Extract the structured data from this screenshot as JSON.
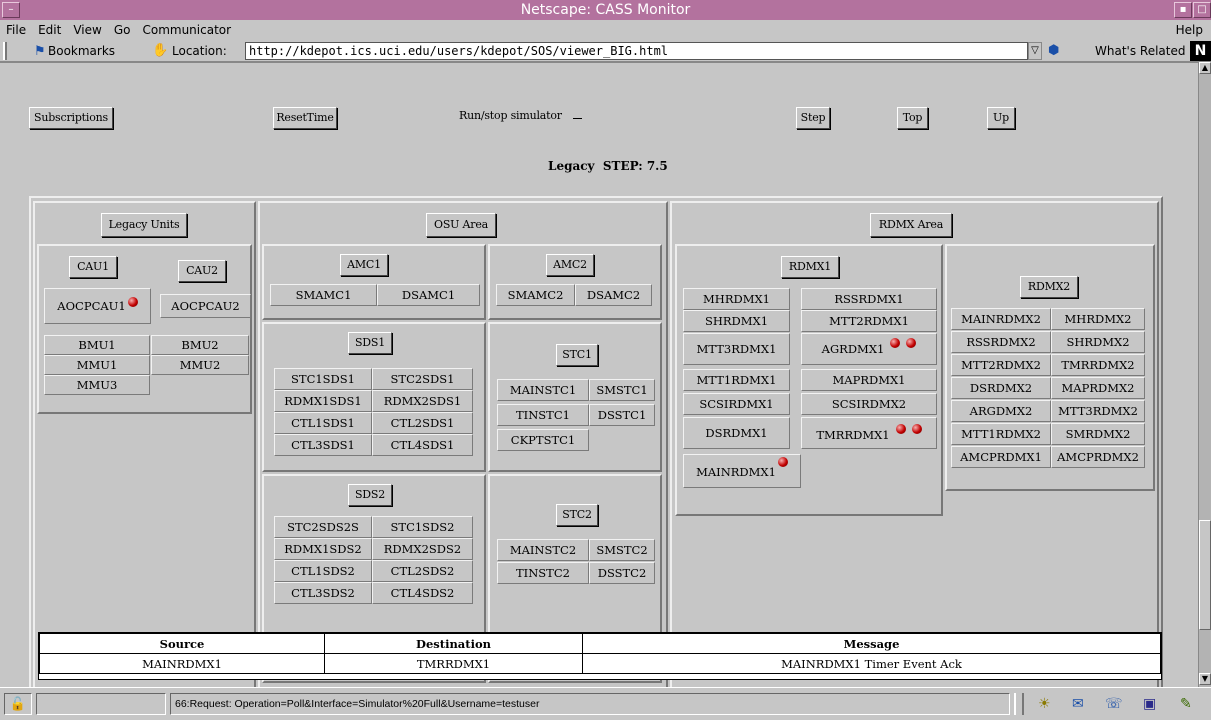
{
  "window": {
    "title": "Netscape: CASS Monitor"
  },
  "menu": {
    "items": [
      "File",
      "Edit",
      "View",
      "Go",
      "Communicator"
    ],
    "help": "Help"
  },
  "location": {
    "bookmarks": "Bookmarks",
    "label": "Location:",
    "url": "http://kdepot.ics.uci.edu/users/kdepot/SOS/viewer_BIG.html",
    "related": "What's Related"
  },
  "toolbar": {
    "subscriptions": "Subscriptions",
    "reset_time": "ResetTime",
    "run_stop": "Run/stop simulator",
    "step": "Step",
    "top": "Top",
    "up": "Up"
  },
  "header": {
    "legacy": "Legacy",
    "step": "STEP: 7.5"
  },
  "legacy_area": {
    "title": "Legacy Units",
    "cau1": "CAU1",
    "cau2": "CAU2",
    "aocpcau1": "AOCPCAU1",
    "aocpcau2": "AOCPCAU2",
    "bmu1": "BMU1",
    "bmu2": "BMU2",
    "mmu1": "MMU1",
    "mmu2": "MMU2",
    "mmu3": "MMU3"
  },
  "osu_area": {
    "title": "OSU Area",
    "amc1": {
      "title": "AMC1",
      "items": [
        "SMAMC1",
        "DSAMC1"
      ]
    },
    "amc2": {
      "title": "AMC2",
      "items": [
        "SMAMC2",
        "DSAMC2"
      ]
    },
    "sds1": {
      "title": "SDS1",
      "items": [
        "STC1SDS1",
        "STC2SDS1",
        "RDMX1SDS1",
        "RDMX2SDS1",
        "CTL1SDS1",
        "CTL2SDS1",
        "CTL3SDS1",
        "CTL4SDS1"
      ]
    },
    "stc1": {
      "title": "STC1",
      "items": [
        "MAINSTC1",
        "SMSTC1",
        "TINSTC1",
        "DSSTC1",
        "CKPTSTC1"
      ]
    },
    "sds2": {
      "title": "SDS2",
      "items": [
        "STC2SDS2S",
        "STC1SDS2",
        "RDMX1SDS2",
        "RDMX2SDS2",
        "CTL1SDS2",
        "CTL2SDS2",
        "CTL3SDS2",
        "CTL4SDS2"
      ]
    },
    "stc2": {
      "title": "STC2",
      "items": [
        "MAINSTC2",
        "SMSTC2",
        "TINSTC2",
        "DSSTC2"
      ]
    }
  },
  "rdmx_area": {
    "title": "RDMX Area",
    "rdmx1": {
      "title": "RDMX1",
      "items": [
        "MHRDMX1",
        "RSSRDMX1",
        "SHRDMX1",
        "MTT2RDMX1",
        "MTT3RDMX1",
        "AGRDMX1",
        "MTT1RDMX1",
        "MAPRDMX1",
        "SCSIRDMX1",
        "SCSIRDMX2",
        "DSRDMX1",
        "TMRRDMX1",
        "MAINRDMX1"
      ]
    },
    "rdmx2": {
      "title": "RDMX2",
      "items": [
        "MAINRDMX2",
        "MHRDMX2",
        "RSSRDMX2",
        "SHRDMX2",
        "MTT2RDMX2",
        "TMRRDMX2",
        "DSRDMX2",
        "MAPRDMX2",
        "ARGDMX2",
        "MTT3RDMX2",
        "MTT1RDMX2",
        "SMRDMX2",
        "AMCPRDMX1",
        "AMCPRDMX2"
      ]
    }
  },
  "messages": {
    "headers": [
      "Source",
      "Destination",
      "Message"
    ],
    "rows": [
      [
        "MAINRDMX1",
        "TMRRDMX1",
        "MAINRDMX1 Timer Event Ack"
      ]
    ]
  },
  "status": {
    "text": "66:Request: Operation=Poll&Interface=Simulator%20Full&Username=testuser"
  },
  "colors": {
    "titlebar": "#b3729e",
    "background": "#c6c6c6",
    "indicator": "#c20000"
  },
  "icons": [
    "lock-icon",
    "bookmark-icon",
    "location-icon",
    "whats-related-icon",
    "netscape-logo-icon",
    "component-bar-icons"
  ]
}
